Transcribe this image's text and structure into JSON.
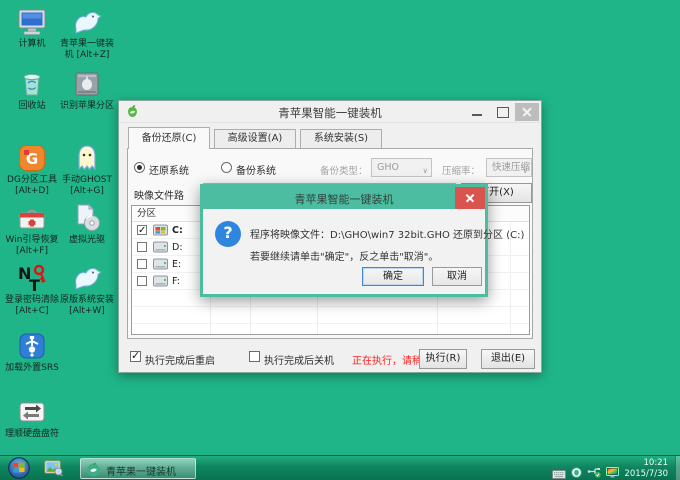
{
  "colors": {
    "desktop_bg": "#1fb588",
    "taskbar_green": "#0f8560",
    "dialog_teal": "#4cbda0",
    "close_red": "#d9534f",
    "status_red": "#ff2222",
    "question_blue": "#2e86de",
    "apple_green": "#57b847"
  },
  "desktop": {
    "icons": [
      {
        "name": "computer",
        "label": "计算机"
      },
      {
        "name": "green-apple-installer",
        "label": "青苹果一键装机 [Alt+Z]"
      },
      {
        "name": "recycle-bin",
        "label": "回收站"
      },
      {
        "name": "identify-apple-partition",
        "label": "识别苹果分区"
      },
      {
        "name": "dg-partition-tool",
        "label": "DG分区工具 [Alt+D]"
      },
      {
        "name": "manual-ghost",
        "label": "手动GHOST [Alt+G]"
      },
      {
        "name": "win-boot-repair",
        "label": "Win引导恢复 [Alt+F]"
      },
      {
        "name": "virtual-cd",
        "label": "虚拟光驱"
      },
      {
        "name": "login-password-clear",
        "label": "登录密码清除 [Alt+C]"
      },
      {
        "name": "original-system-install",
        "label": "原版系统安装 [Alt+W]"
      },
      {
        "name": "load-external-srs",
        "label": "加载外置SRS"
      },
      {
        "name": "fix-drive-letters",
        "label": "理顺硬盘盘符"
      }
    ]
  },
  "window": {
    "title": "青苹果智能一键装机",
    "tabs": [
      {
        "label": "备份还原(C)",
        "active": true
      },
      {
        "label": "高级设置(A)",
        "active": false
      },
      {
        "label": "系统安装(S)",
        "active": false
      }
    ],
    "restore_tab": {
      "radio_restore": {
        "label": "还原系统",
        "selected": true
      },
      "radio_backup": {
        "label": "备份系统",
        "selected": false
      },
      "backup_type": {
        "label": "备份类型：",
        "value": "GHO",
        "disabled": true
      },
      "compression": {
        "label": "压缩率：",
        "value": "快速压缩",
        "disabled": true
      },
      "image_path_label": "映像文件路",
      "open_button": "打开(X)",
      "partition_table": {
        "header": "分区",
        "rows": [
          {
            "drive": "C:",
            "checked": true
          },
          {
            "drive": "D:",
            "checked": false
          },
          {
            "drive": "E:",
            "checked": false
          },
          {
            "drive": "F:",
            "checked": false
          }
        ]
      },
      "reboot_checkbox": {
        "label": "执行完成后重启",
        "checked": true
      },
      "shutdown_checkbox": {
        "label": "执行完成后关机",
        "checked": false
      },
      "status_text": "正在执行，请稍候...",
      "run_button": "执行(R)",
      "exit_button": "退出(E)"
    }
  },
  "dialog": {
    "title": "青苹果智能一键装机",
    "message_line1": "程序将映像文件：D:\\GHO\\win7 32bit.GHO 还原到分区 (C:)",
    "message_line2": "若要继续请单击\"确定\"，反之单击\"取消\"。",
    "ok_button": "确定",
    "cancel_button": "取消"
  },
  "taskbar": {
    "task_button_label": "青苹果一键装机",
    "clock": {
      "time": "10:21",
      "date": "2015/7/30"
    }
  }
}
